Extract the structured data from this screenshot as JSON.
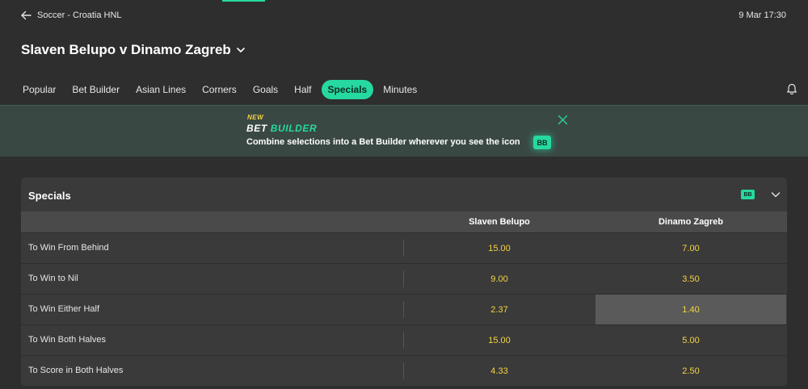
{
  "header": {
    "breadcrumb": "Soccer - Croatia HNL",
    "datetime": "9 Mar 17:30",
    "match_title": "Slaven Belupo v Dinamo Zagreb"
  },
  "tabs": [
    {
      "label": "Popular"
    },
    {
      "label": "Bet Builder"
    },
    {
      "label": "Asian Lines"
    },
    {
      "label": "Corners"
    },
    {
      "label": "Goals"
    },
    {
      "label": "Half"
    },
    {
      "label": "Specials",
      "active": true
    },
    {
      "label": "Minutes"
    }
  ],
  "promo": {
    "new_label": "NEW",
    "title_word1": "BET",
    "title_word2": "BUILDER",
    "text": "Combine selections into a Bet Builder wherever you see the icon",
    "badge": "BB"
  },
  "specials": {
    "title": "Specials",
    "badge": "BB",
    "columns": [
      "Slaven Belupo",
      "Dinamo Zagreb"
    ],
    "rows": [
      {
        "label": "To Win From Behind",
        "odds": [
          "15.00",
          "7.00"
        ]
      },
      {
        "label": "To Win to Nil",
        "odds": [
          "9.00",
          "3.50"
        ]
      },
      {
        "label": "To Win Either Half",
        "odds": [
          "2.37",
          "1.40"
        ],
        "selected": 1
      },
      {
        "label": "To Win Both Halves",
        "odds": [
          "15.00",
          "5.00"
        ]
      },
      {
        "label": "To Score in Both Halves",
        "odds": [
          "4.33",
          "2.50"
        ]
      }
    ]
  },
  "colors": {
    "accent": "#26d9a0",
    "odds": "#f5d442",
    "background": "#2e2e2e",
    "panel": "#3a3a3a"
  },
  "icons": [
    "back-arrow-icon",
    "chevron-down-icon",
    "bell-icon",
    "close-icon",
    "bet-builder-icon"
  ]
}
